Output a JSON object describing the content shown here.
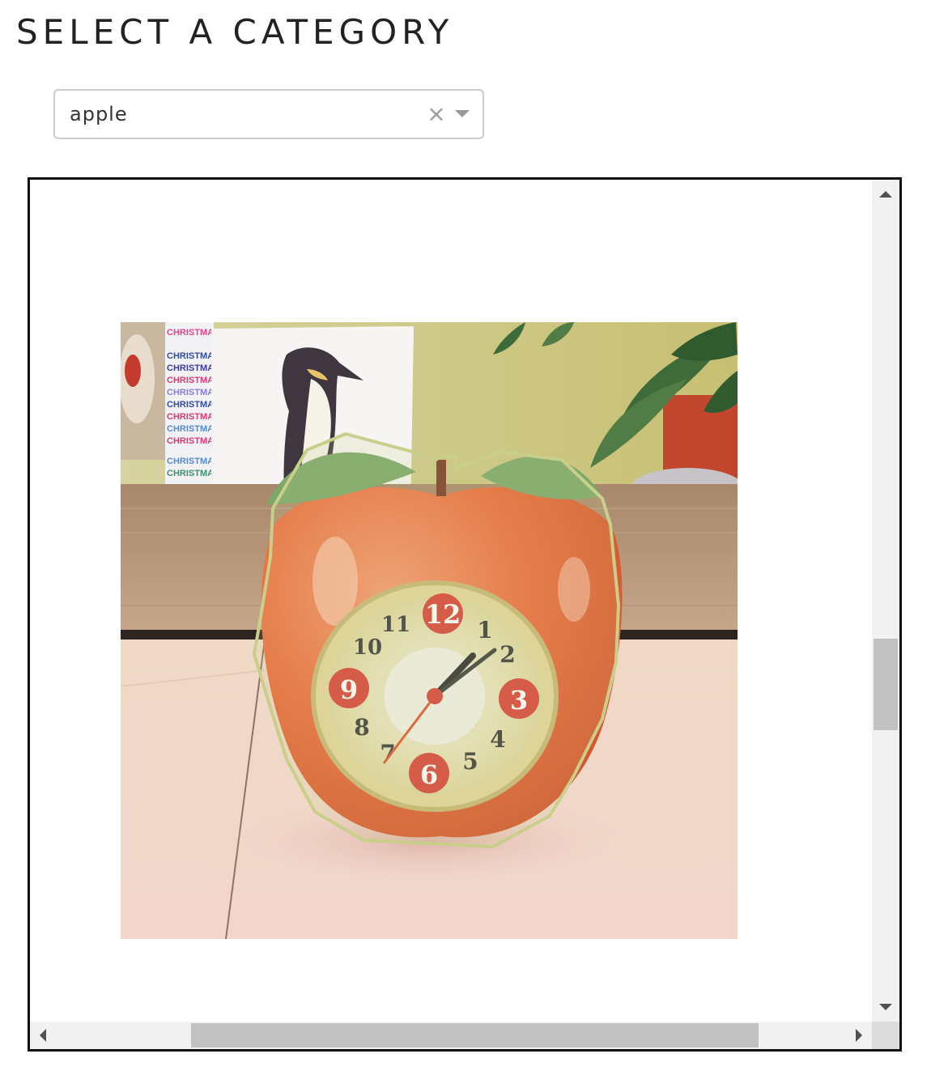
{
  "page": {
    "heading": "SELECT A CATEGORY"
  },
  "category_select": {
    "selected_value": "apple",
    "clear_symbol": "×",
    "clear_icon": "close-icon",
    "dropdown_icon": "chevron-down-icon"
  },
  "viewer": {
    "annotation_color": "#c9cf8a",
    "vertical_scroll_position": 0.6,
    "horizontal_scroll_position": 0.2,
    "photo": {
      "penguin_card_text": [
        "CHRISTMA",
        "CHRISTMA",
        "CHRISTMA",
        "CHRISTMA",
        "CHRISTMA",
        "CHRISTMA",
        "CHRISTMA",
        "CHRISTMA",
        "CHRISTMA",
        "CHRISTMA",
        "CHRISTMA"
      ],
      "clock_numbers": [
        "12",
        "1",
        "2",
        "3",
        "4",
        "5",
        "6",
        "7",
        "8",
        "9",
        "10",
        "11"
      ]
    }
  }
}
